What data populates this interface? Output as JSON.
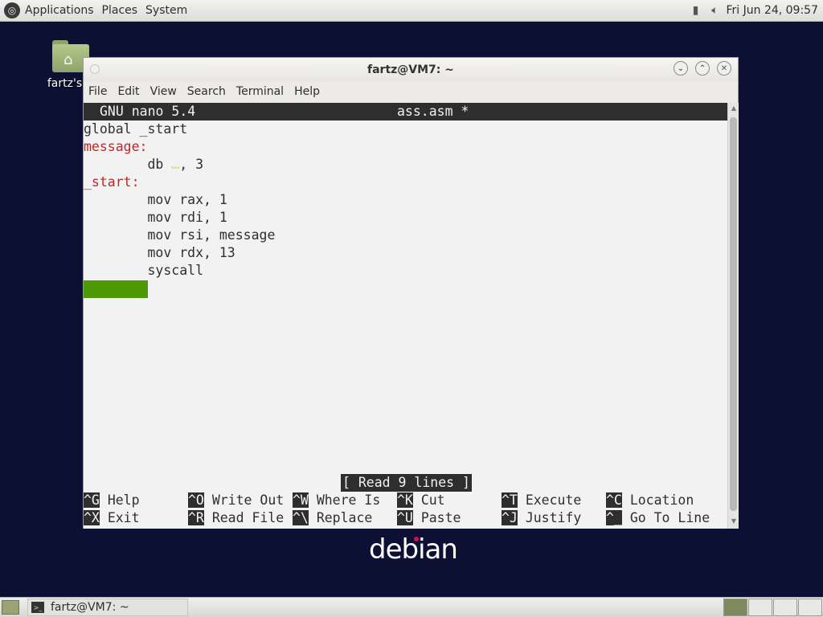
{
  "top_panel": {
    "menus": [
      "Applications",
      "Places",
      "System"
    ],
    "clock": "Fri Jun 24, 09:57"
  },
  "desktop": {
    "home_icon_label": "fartz's H"
  },
  "window": {
    "title": "fartz@VM7: ~",
    "menus": [
      "File",
      "Edit",
      "View",
      "Search",
      "Terminal",
      "Help"
    ]
  },
  "nano": {
    "version": "GNU nano 5.4",
    "filename": "ass.asm *",
    "lines": [
      {
        "text": "global _start"
      },
      {
        "label": "message:"
      },
      {
        "indent": "        db ",
        "string": "…",
        "rest": ", 3"
      },
      {
        "label": "_start:"
      },
      {
        "text": "        mov rax, 1"
      },
      {
        "text": "        mov rdi, 1"
      },
      {
        "text": "        mov rsi, message"
      },
      {
        "text": "        mov rdx, 13"
      },
      {
        "text": "        syscall"
      }
    ],
    "status": "[ Read 9 lines ]",
    "shortcuts": [
      {
        "key": "^G",
        "label": "Help"
      },
      {
        "key": "^O",
        "label": "Write Out"
      },
      {
        "key": "^W",
        "label": "Where Is"
      },
      {
        "key": "^K",
        "label": "Cut"
      },
      {
        "key": "^T",
        "label": "Execute"
      },
      {
        "key": "^C",
        "label": "Location"
      },
      {
        "key": "^X",
        "label": "Exit"
      },
      {
        "key": "^R",
        "label": "Read File"
      },
      {
        "key": "^\\",
        "label": "Replace"
      },
      {
        "key": "^U",
        "label": "Paste"
      },
      {
        "key": "^J",
        "label": "Justify"
      },
      {
        "key": "^_",
        "label": "Go To Line"
      }
    ]
  },
  "wallpaper_logo": "debian",
  "taskbar": {
    "task_title": "fartz@VM7: ~"
  },
  "colors": {
    "desktop_bg": "#0c1033",
    "label_red": "#cc2222",
    "string_yellow": "#e6d85a",
    "cursor_green": "#4e9a06"
  }
}
